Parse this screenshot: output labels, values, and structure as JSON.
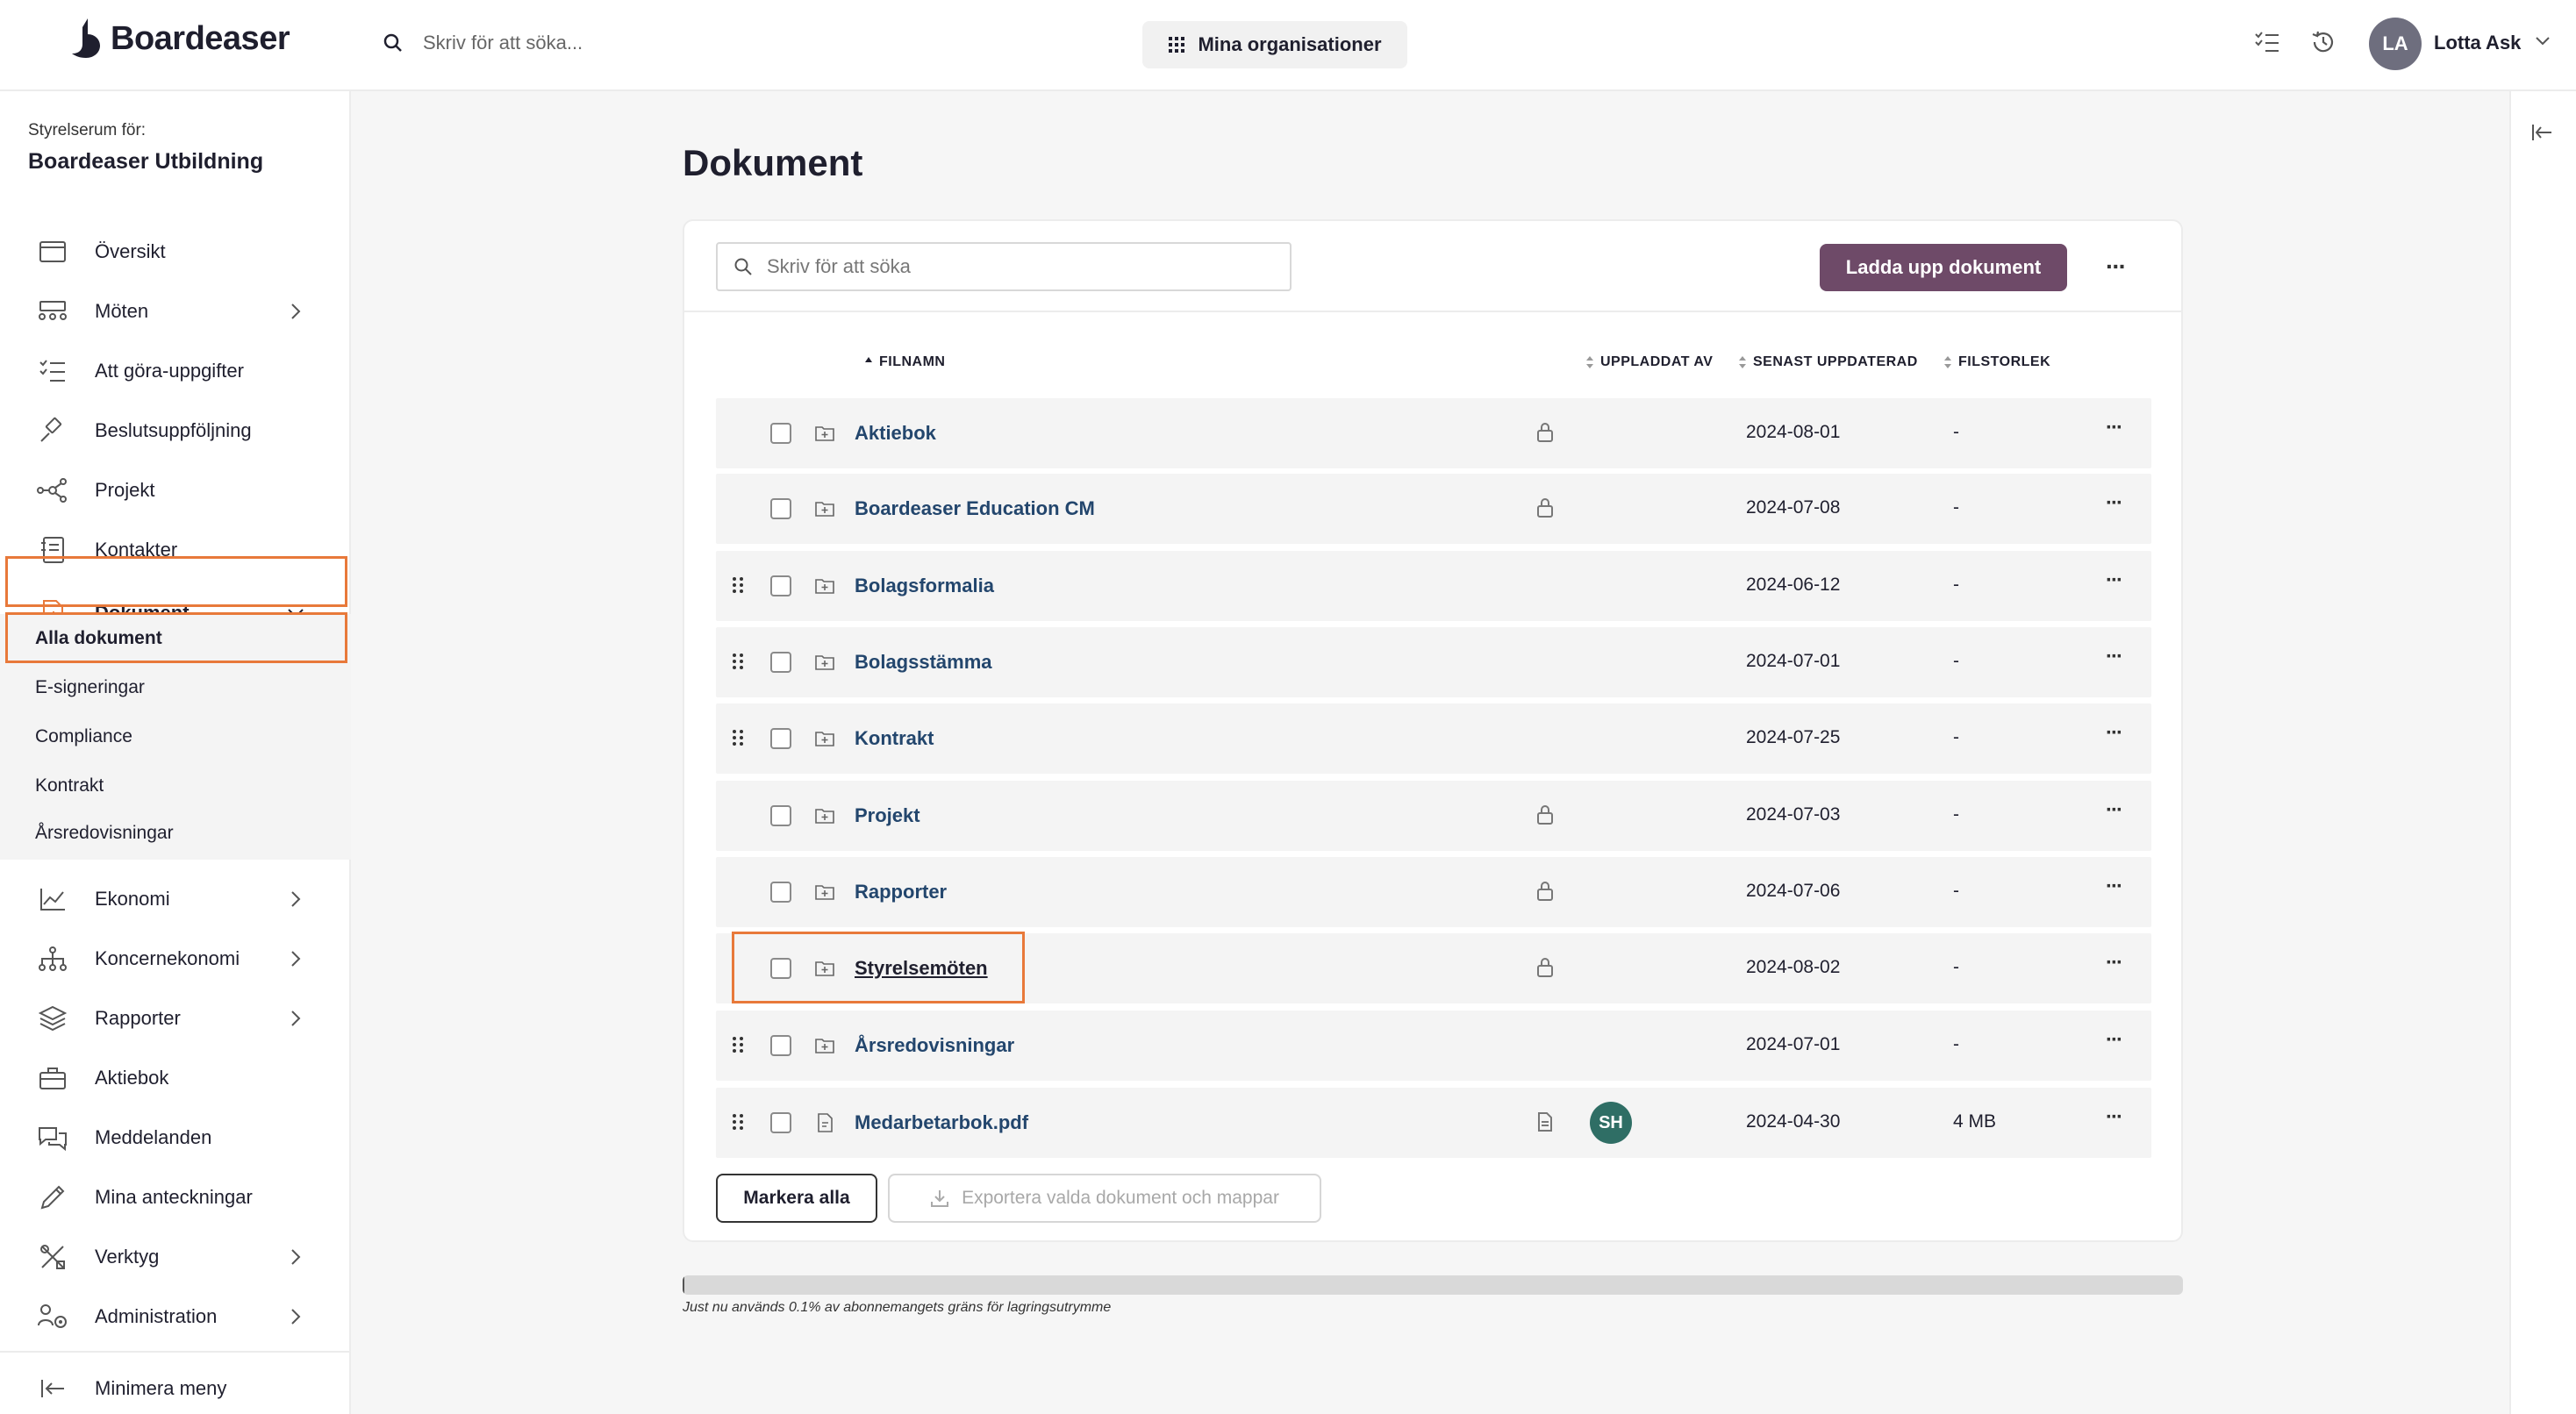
{
  "header": {
    "logo_text": "Boardeaser",
    "search_placeholder": "Skriv för att söka...",
    "org_button_label": "Mina organisationer",
    "user_initials": "LA",
    "user_name": "Lotta Ask"
  },
  "sidebar": {
    "room_label": "Styrelserum för:",
    "room_name": "Boardeaser Utbildning",
    "items": [
      {
        "label": "Översikt",
        "icon": "overview-icon"
      },
      {
        "label": "Möten",
        "icon": "meetings-icon"
      },
      {
        "label": "Att göra-uppgifter",
        "icon": "todo-list-icon"
      },
      {
        "label": "Beslutsuppföljning",
        "icon": "gavel-icon"
      },
      {
        "label": "Projekt",
        "icon": "project-network-icon"
      },
      {
        "label": "Kontakter",
        "icon": "contacts-book-icon"
      },
      {
        "label": "Dokument",
        "icon": "document-icon"
      },
      {
        "label": "Ekonomi",
        "icon": "economy-chart-icon"
      },
      {
        "label": "Koncernekonomi",
        "icon": "group-hierarchy-icon"
      },
      {
        "label": "Rapporter",
        "icon": "reports-layers-icon"
      },
      {
        "label": "Aktiebok",
        "icon": "briefcase-icon"
      },
      {
        "label": "Meddelanden",
        "icon": "messages-icon"
      },
      {
        "label": "Mina anteckningar",
        "icon": "pen-icon"
      },
      {
        "label": "Verktyg",
        "icon": "tools-icon"
      },
      {
        "label": "Administration",
        "icon": "admin-users-icon"
      }
    ],
    "document_submenu": [
      "Alla dokument",
      "E-signeringar",
      "Compliance",
      "Kontrakt",
      "Årsredovisningar"
    ],
    "minimize_label": "Minimera meny"
  },
  "main": {
    "page_title": "Dokument",
    "search_placeholder": "Skriv för att söka",
    "upload_button": "Ladda upp dokument",
    "more_label": "···",
    "columns": {
      "filename": "FILNAMN",
      "uploaded_by": "UPPLADDAT AV",
      "last_updated": "SENAST UPPDATERAD",
      "filesize": "FILSTORLEK"
    },
    "rows": [
      {
        "name": "Aktiebok",
        "type": "folder",
        "locked": true,
        "draggable": false,
        "uploader": "",
        "date": "2024-08-01",
        "size": "-"
      },
      {
        "name": "Boardeaser Education CM",
        "type": "folder",
        "locked": true,
        "draggable": false,
        "uploader": "",
        "date": "2024-07-08",
        "size": "-"
      },
      {
        "name": "Bolagsformalia",
        "type": "folder",
        "locked": false,
        "draggable": true,
        "uploader": "",
        "date": "2024-06-12",
        "size": "-"
      },
      {
        "name": "Bolagsstämma",
        "type": "folder",
        "locked": false,
        "draggable": true,
        "uploader": "",
        "date": "2024-07-01",
        "size": "-"
      },
      {
        "name": "Kontrakt",
        "type": "folder",
        "locked": false,
        "draggable": true,
        "uploader": "",
        "date": "2024-07-25",
        "size": "-"
      },
      {
        "name": "Projekt",
        "type": "folder",
        "locked": true,
        "draggable": false,
        "uploader": "",
        "date": "2024-07-03",
        "size": "-"
      },
      {
        "name": "Rapporter",
        "type": "folder",
        "locked": true,
        "draggable": false,
        "uploader": "",
        "date": "2024-07-06",
        "size": "-"
      },
      {
        "name": "Styrelsemöten",
        "type": "folder",
        "locked": true,
        "draggable": false,
        "uploader": "",
        "date": "2024-08-02",
        "size": "-"
      },
      {
        "name": "Årsredovisningar",
        "type": "folder",
        "locked": false,
        "draggable": true,
        "uploader": "",
        "date": "2024-07-01",
        "size": "-"
      },
      {
        "name": "Medarbetarbok.pdf",
        "type": "file",
        "locked": false,
        "draggable": true,
        "uploader": "SH",
        "date": "2024-04-30",
        "size": "4 MB"
      }
    ],
    "mark_all_button": "Markera alla",
    "export_button": "Exportera valda dokument och mappar",
    "storage_used_percent": 0.1,
    "storage_text": "Just nu används 0.1% av abonnemangets gräns för lagringsutrymme"
  },
  "colors": {
    "accent": "#6e4a68",
    "highlight": "#e8793a",
    "link": "#23466d",
    "uploader_avatar": "#2f6e65"
  }
}
